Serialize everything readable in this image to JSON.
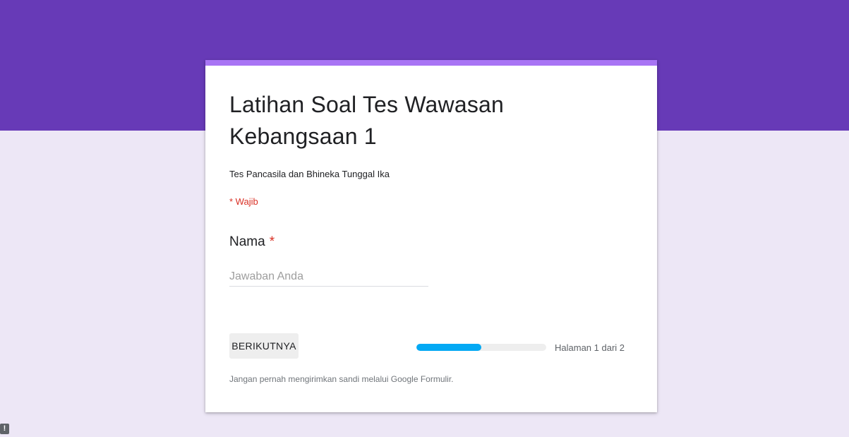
{
  "form": {
    "title": "Latihan Soal Tes Wawasan Kebangsaan 1",
    "description": "Tes Pancasila dan Bhineka Tunggal Ika",
    "required_note": "* Wajib"
  },
  "question": {
    "label": "Nama",
    "required_marker": "*",
    "placeholder": "Jawaban Anda",
    "value": ""
  },
  "navigation": {
    "next_label": "BERIKUTNYA",
    "progress_fraction": 0.5,
    "page_indicator": "Halaman 1 dari 2"
  },
  "footer": {
    "note": "Jangan pernah mengirimkan sandi melalui Google Formulir."
  },
  "report_icon": {
    "glyph": "!"
  },
  "colors": {
    "header": "#673ab7",
    "background": "#ede7f6",
    "accent": "#a874f4",
    "progress": "#03a9f4",
    "required": "#d93025"
  }
}
